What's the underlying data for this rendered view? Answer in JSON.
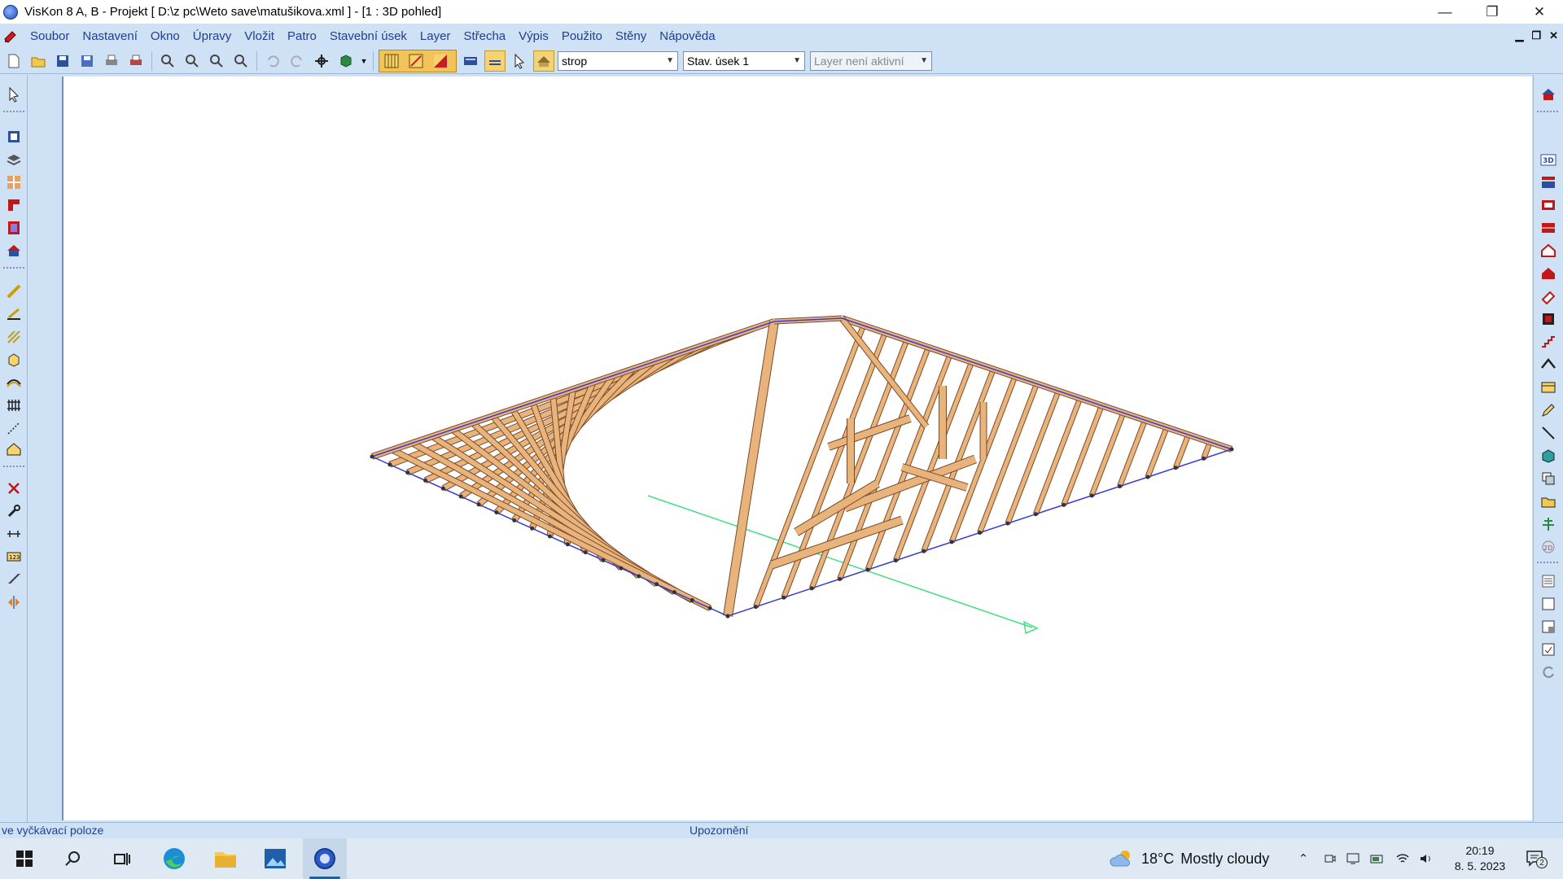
{
  "window": {
    "title": "VisKon 8 A, B - Projekt [ D:\\z pc\\Weto save\\matušikova.xml ]  - [1 : 3D pohled]",
    "controls": {
      "minimize": "—",
      "restore": "❐",
      "close": "✕"
    }
  },
  "menu": {
    "items": [
      "Soubor",
      "Nastavení",
      "Okno",
      "Úpravy",
      "Vložit",
      "Patro",
      "Stavební úsek",
      "Layer",
      "Střecha",
      "Výpis",
      "Použito",
      "Stěny",
      "Nápověda"
    ],
    "mdi_controls": {
      "minimize": "▁",
      "restore": "❐",
      "close": "✕"
    }
  },
  "toolbar": {
    "combo_floor": "strop",
    "combo_section": "Stav. úsek 1",
    "combo_layer": "Layer není aktivní"
  },
  "statusbar": {
    "left": "ve vyčkávací poloze",
    "center": "Upozornění"
  },
  "taskbar": {
    "weather_temp": "18°C",
    "weather_text": "Mostly cloudy",
    "time": "20:19",
    "date": "8. 5. 2023",
    "notification_count": "2"
  },
  "colors": {
    "chrome": "#cfe1f4",
    "timber": "#e8b47c",
    "timber_edge": "#7a4a2a",
    "eave_line": "#3a3ad0",
    "axis_line": "#40e080"
  }
}
